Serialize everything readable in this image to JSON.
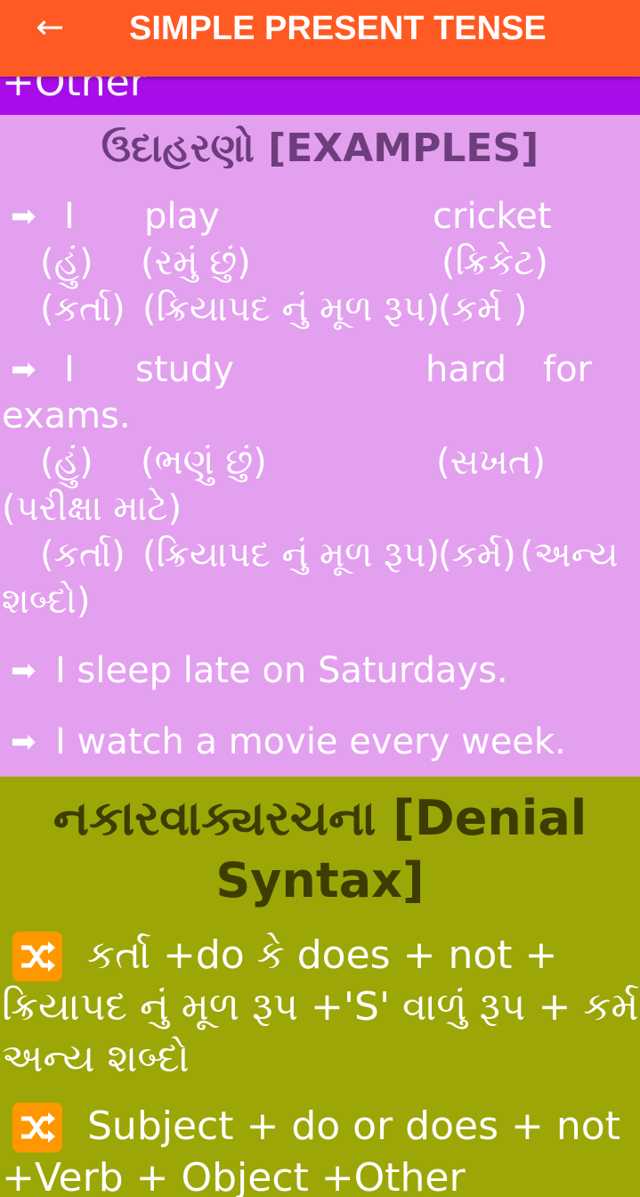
{
  "appbar": {
    "title": "SIMPLE PRESENT TENSE",
    "back_icon": "←"
  },
  "top_strip": {
    "text": "+Other"
  },
  "examples": {
    "heading": "ઉદાહરણો [EXAMPLES]",
    "arrow_icon": "➡",
    "ex1": {
      "line1": {
        "a": "I",
        "b": "play",
        "c": "cricket"
      },
      "line2": {
        "a": "(હું)",
        "b": "(રમું  છું)",
        "c": "(ક્રિકેટ)"
      },
      "line3": {
        "a": "(કર્તા)",
        "b": "(ક્રિયાપદ નું મૂળ રૂપ)",
        "c": "(કર્મ )"
      }
    },
    "ex2": {
      "line1": {
        "a": "I",
        "b": "study",
        "c": "hard",
        "d": "for"
      },
      "line1b": "exams.",
      "line2": {
        "a": "(હું)",
        "b": "(ભણું છું)",
        "c": "(સખત)"
      },
      "line2b": "(પરીક્ષા માટે)",
      "line3": {
        "a": "(કર્તા)",
        "b": "(ક્રિયાપદ નું મૂળ રૂપ)",
        "c": "(કર્મ)",
        "d": "(અન્ય"
      },
      "line3b": "શબ્દો)"
    },
    "ex3": "I sleep late on Saturdays.",
    "ex4": "I watch a movie every week."
  },
  "denial": {
    "heading": "નકારવાક્યરચના [Denial Syntax]",
    "shuffle_icon": "shuffle-icon",
    "rule1": {
      "line1": "કર્તા +do કે does + not +",
      "line2": "ક્રિયાપદ નું મૂળ રૂપ +'S' વાળું રૂપ + કર્મ +",
      "line3": "અન્ય શબ્દો"
    },
    "rule2": {
      "line1": "Subject + do or does + not",
      "line2": "+Verb + Object +Other"
    }
  },
  "colors": {
    "appbar": "#ff5a23",
    "purple_strip": "#a80de9",
    "examples_bg": "#e3a0ef",
    "denial_bg": "#9ca606",
    "shuffle_icon_bg": "#ff9800"
  }
}
